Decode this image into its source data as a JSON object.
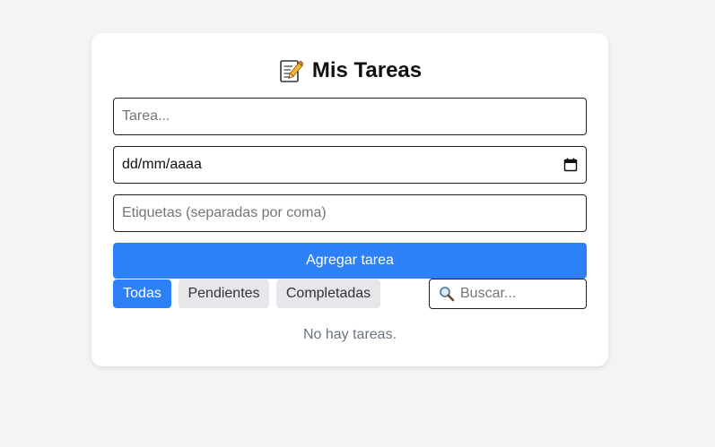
{
  "app": {
    "title": "Mis Tareas",
    "title_icon": "memo-icon"
  },
  "form": {
    "task_placeholder": "Tarea...",
    "date_value": "dd/mm/aaaa",
    "tags_placeholder": "Etiquetas (separadas por coma)",
    "add_button_label": "Agregar tarea"
  },
  "filters": {
    "all_label": "Todas",
    "pending_label": "Pendientes",
    "completed_label": "Completadas",
    "active": "Todas"
  },
  "search": {
    "placeholder": "Buscar..."
  },
  "task_list": {
    "empty_message": "No hay tareas."
  },
  "colors": {
    "accent": "#2e80f7",
    "background": "#f3f4f6",
    "card": "#ffffff",
    "inactive_filter": "#e5e7eb"
  }
}
